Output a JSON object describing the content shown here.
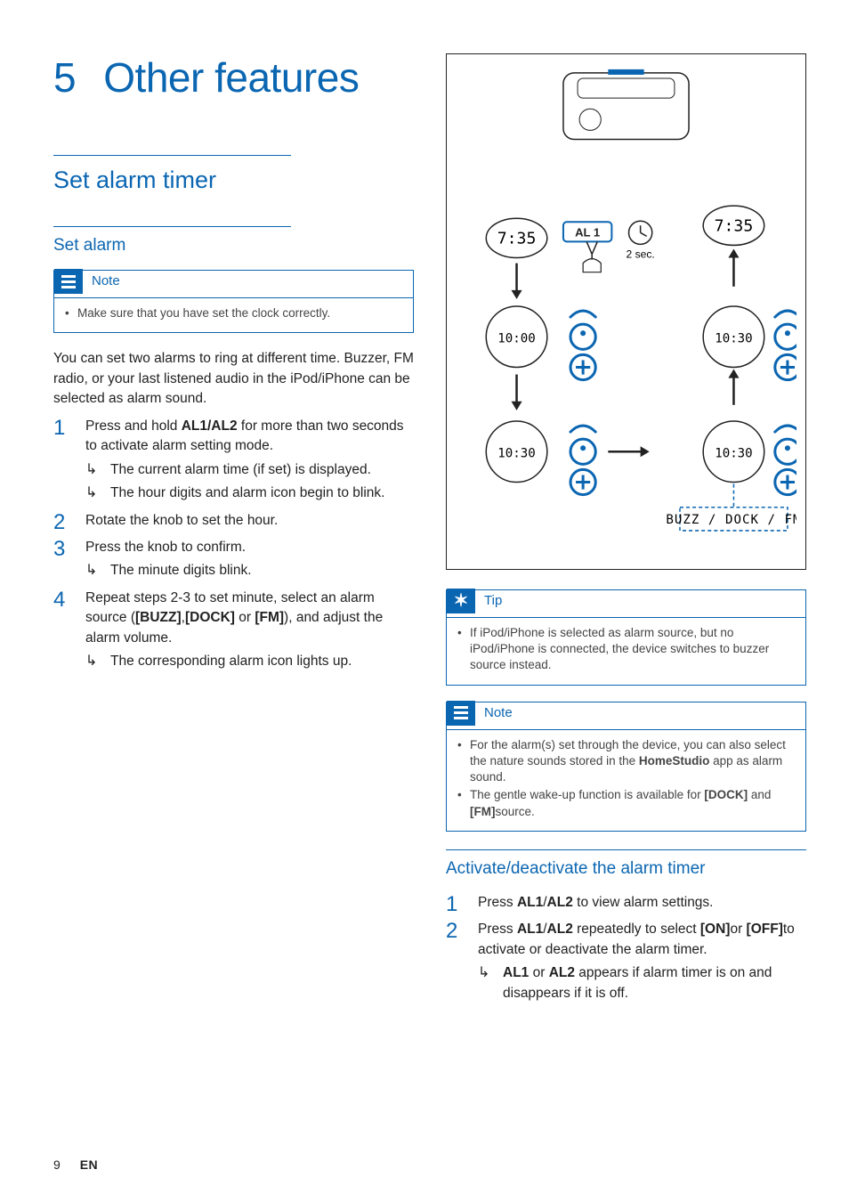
{
  "chapter": {
    "number": "5",
    "title": "Other features"
  },
  "left": {
    "h2": "Set alarm timer",
    "h3": "Set alarm",
    "note": {
      "label": "Note",
      "items": [
        "Make sure that you have set the clock correctly."
      ]
    },
    "intro": "You can set two alarms to ring at different time. Buzzer, FM radio, or your last listened audio in the iPod/iPhone can be selected as alarm sound.",
    "steps": [
      {
        "num": "1",
        "text_pre": "Press and hold ",
        "text_bold": "AL1/AL2",
        "text_post": " for more than two seconds to activate alarm setting mode.",
        "subs": [
          "The current alarm time (if set) is displayed.",
          "The hour digits and alarm icon begin to blink."
        ]
      },
      {
        "num": "2",
        "text_plain": "Rotate the knob to set the hour.",
        "subs": []
      },
      {
        "num": "3",
        "text_plain": "Press the knob to confirm.",
        "subs": [
          "The minute digits blink."
        ]
      },
      {
        "num": "4",
        "text_pre": "Repeat steps 2-3 to set minute, select an alarm source (",
        "bold1": "[BUZZ]",
        "mid1": ",",
        "bold2": "[DOCK]",
        "mid2": " or ",
        "bold3": "[FM]",
        "text_post": "), and adjust the alarm volume.",
        "subs": [
          "The corresponding alarm icon lights up."
        ]
      }
    ]
  },
  "diagram": {
    "al1": "AL 1",
    "two_sec": "2 sec.",
    "t735": "7:35",
    "t1000": "10:00",
    "t1030": "10:30",
    "buzz_dock_fm": "BUZZ / DOCK / FM"
  },
  "right": {
    "tip": {
      "label": "Tip",
      "items": [
        "If iPod/iPhone is selected as alarm source, but no iPod/iPhone is connected, the device switches to buzzer source instead."
      ]
    },
    "note": {
      "label": "Note",
      "items": [
        {
          "pre": "For the alarm(s) set through the device, you can also select the nature sounds stored in the ",
          "bold": "HomeStudio",
          "post": " app as alarm sound."
        },
        {
          "pre": "The gentle wake-up function is available for ",
          "bold": "[DOCK]",
          "mid": " and ",
          "bold2": "[FM]",
          "post": "source."
        }
      ]
    },
    "h3": "Activate/deactivate the alarm timer",
    "steps": [
      {
        "num": "1",
        "pre": "Press ",
        "b1": "AL1",
        "mid1": "/",
        "b2": "AL2",
        "post": " to view alarm settings."
      },
      {
        "num": "2",
        "pre": "Press ",
        "b1": "AL1",
        "mid1": "/",
        "b2": "AL2",
        "mid2": " repeatedly to select ",
        "b3": "[ON]",
        "mid3": "or ",
        "b4": "[OFF]",
        "post": "to activate or deactivate the alarm timer.",
        "subs": [
          {
            "b1": "AL1",
            "mid": " or ",
            "b2": "AL2",
            "post": " appears if alarm timer is on and disappears if it is off."
          }
        ]
      }
    ]
  },
  "footer": {
    "page": "9",
    "lang": "EN"
  }
}
